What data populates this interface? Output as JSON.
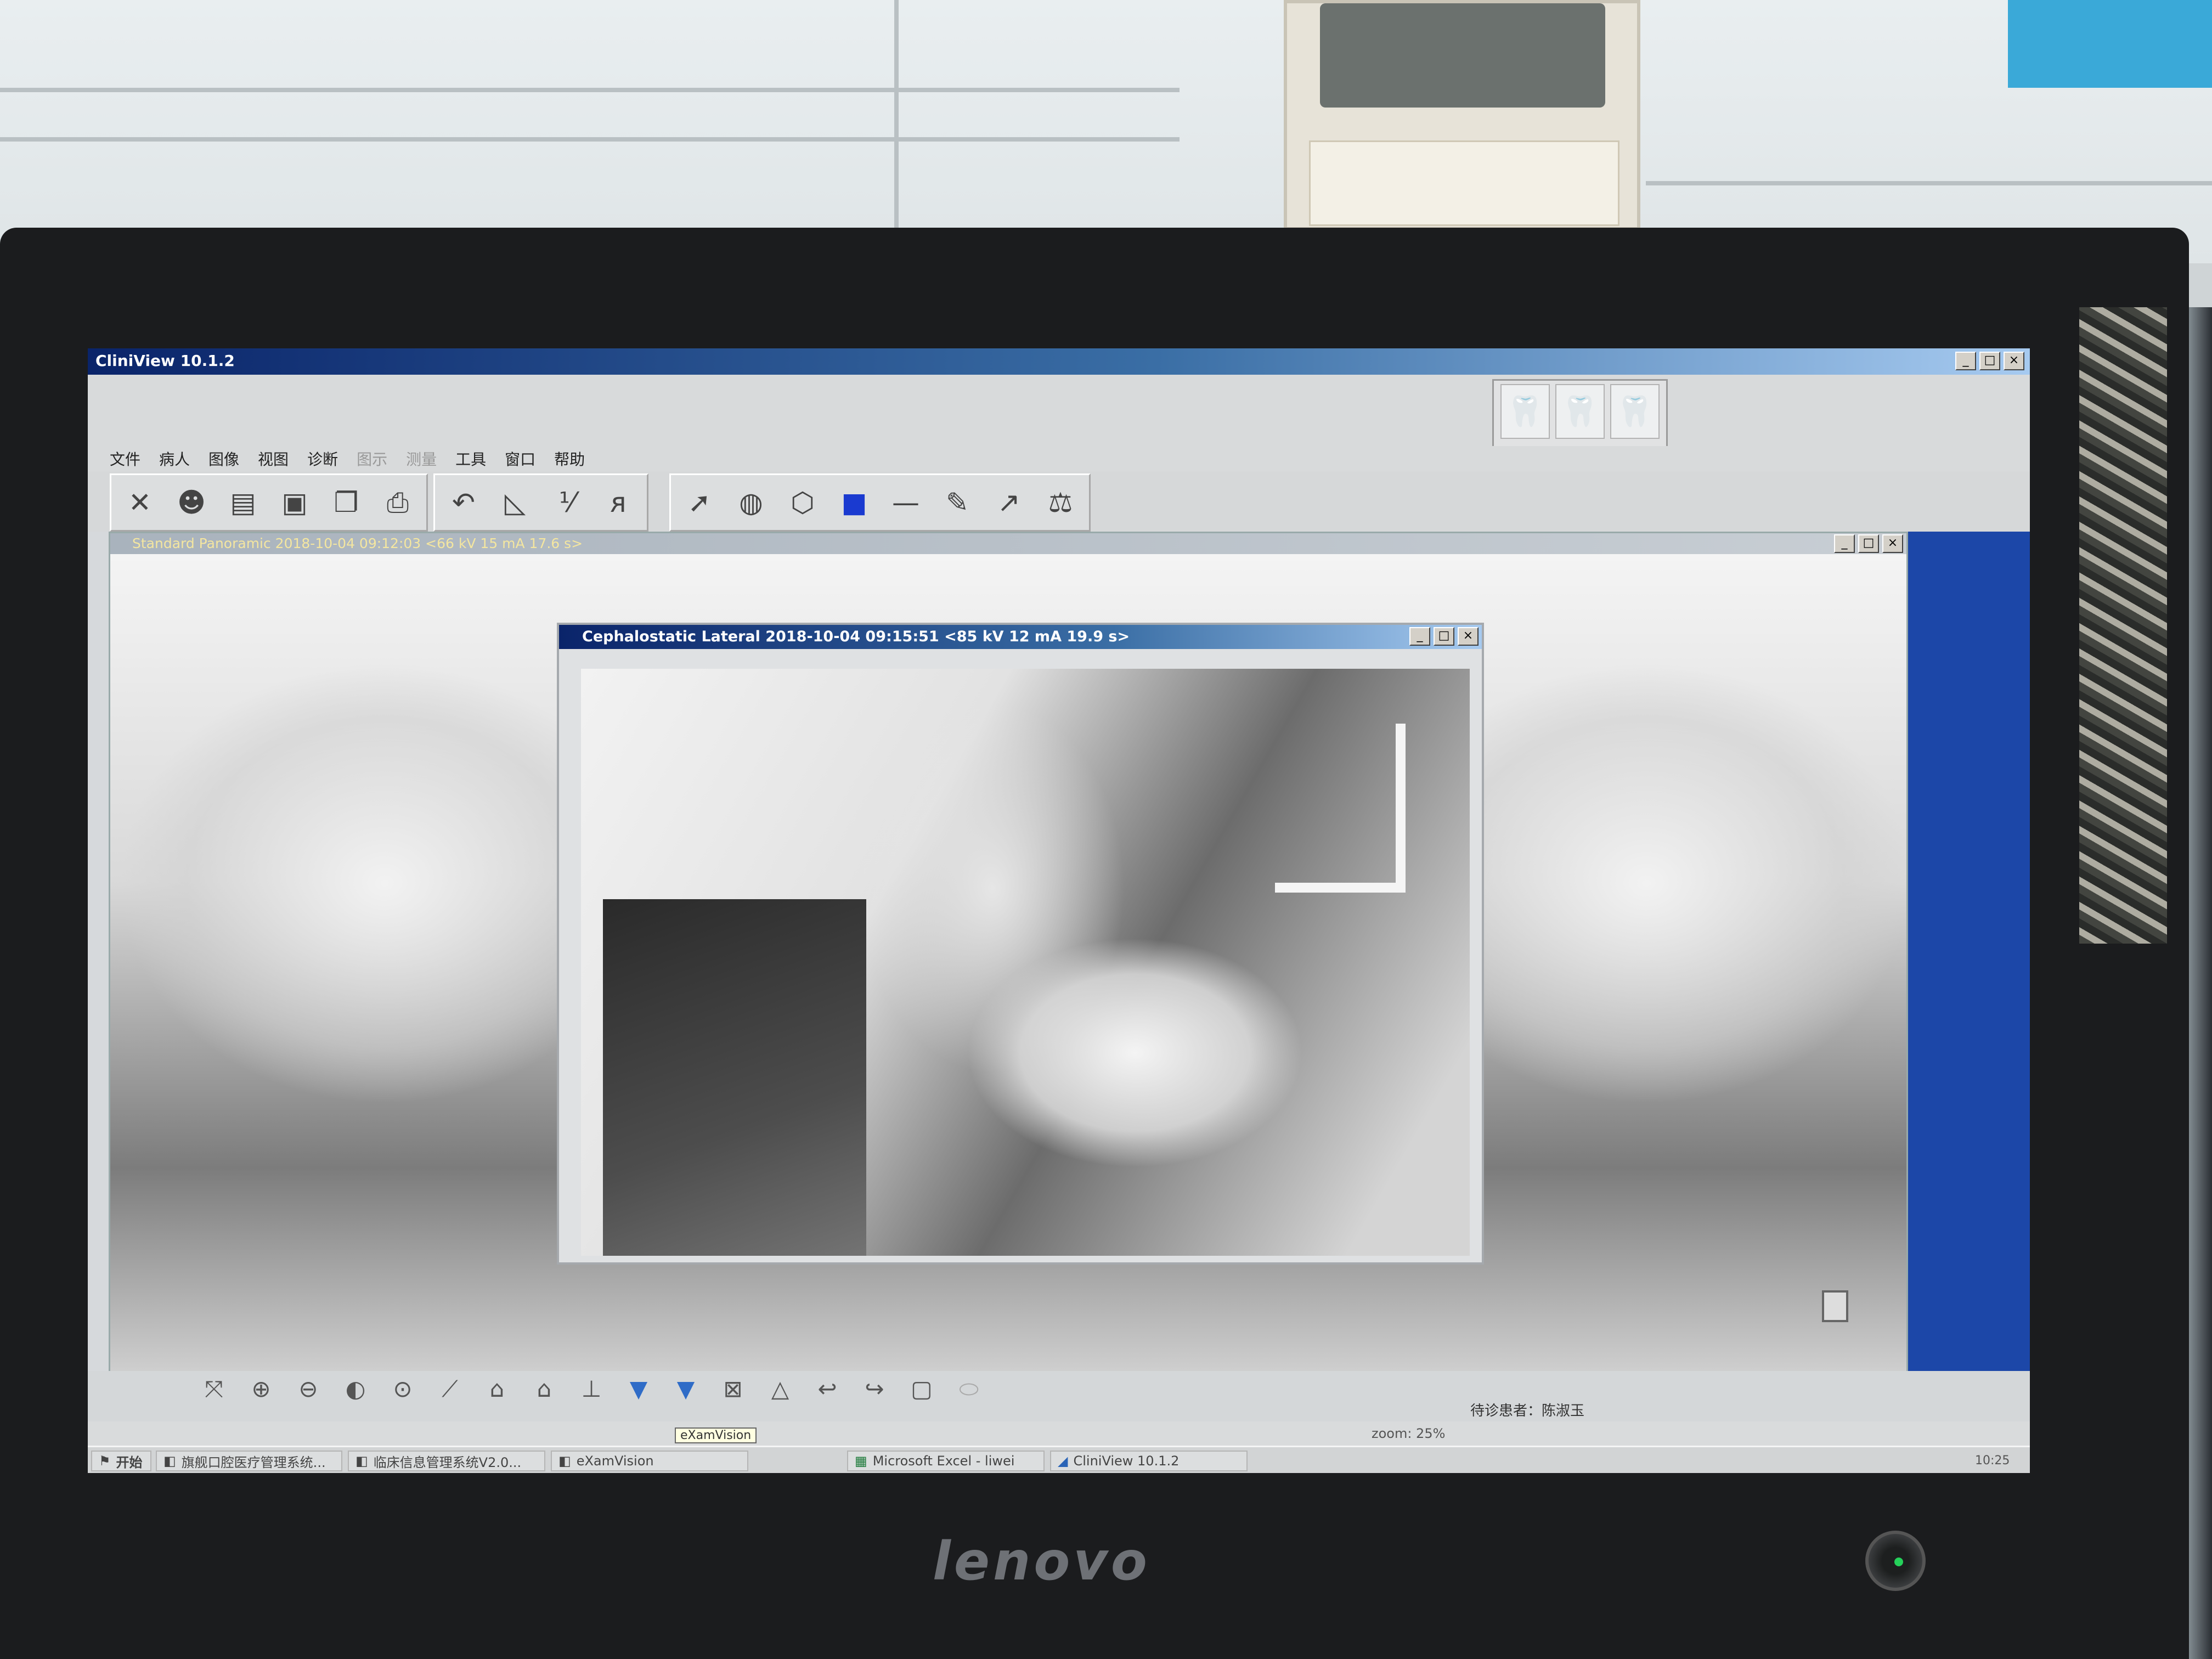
{
  "app": {
    "title": "CliniView 10.1.2",
    "window_controls": [
      "_",
      "□",
      "×"
    ]
  },
  "menu": [
    "文件",
    "病人",
    "图像",
    "视图",
    "诊断",
    "图示",
    "测量",
    "工具",
    "窗口",
    "帮助"
  ],
  "toolbar": {
    "group1": [
      "✕",
      "☻",
      "▤",
      "▣",
      "❐",
      "⎙"
    ],
    "group2": [
      "↶",
      "◺",
      "⅟",
      "ᴙ"
    ],
    "group3": [
      "➚",
      "◍",
      "⬡",
      "■",
      "—",
      "✎",
      "↗",
      "⚖"
    ]
  },
  "tooth_buttons": [
    "🦷",
    "🦷",
    "🦷"
  ],
  "panoramic_window": {
    "title": "Standard Panoramic  2018-10-04 09:12:03  <66 kV 15 mA 17.6 s>"
  },
  "ceph_window": {
    "title": "Cephalostatic Lateral  2018-10-04 09:15:51  <85 kV 12 mA 19.9 s>"
  },
  "bottom_tools": [
    "⤧",
    "⊕",
    "⊖",
    "◐",
    "⊙",
    "⟋",
    "⌂",
    "⌂",
    "⊥",
    "▼",
    "▼",
    "⊠",
    "△",
    "↩",
    "↪",
    "▢",
    "⬭"
  ],
  "status": {
    "zoom": "zoom: 25%",
    "waiting_patient": "待诊患者：陈淑玉"
  },
  "taskbar": {
    "start": "开始",
    "items": [
      "旗舰口腔医疗管理系统...",
      "临床信息管理系统V2.0...",
      "eXamVision",
      "Microsoft Excel - liwei",
      "CliniView 10.1.2"
    ],
    "tooltip": "eXamVision",
    "clock": "10:25"
  },
  "monitor_brand": "lenovo"
}
